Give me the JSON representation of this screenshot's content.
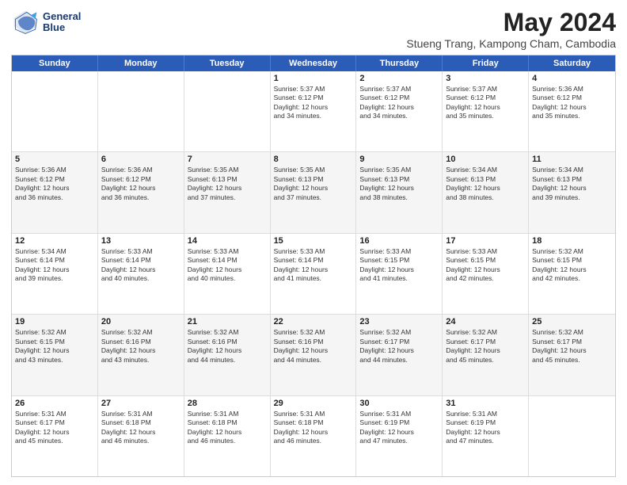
{
  "logo": {
    "line1": "General",
    "line2": "Blue"
  },
  "title": {
    "month_year": "May 2024",
    "location": "Stueng Trang, Kampong Cham, Cambodia"
  },
  "weekdays": [
    "Sunday",
    "Monday",
    "Tuesday",
    "Wednesday",
    "Thursday",
    "Friday",
    "Saturday"
  ],
  "rows": [
    {
      "alt": false,
      "cells": [
        {
          "day": "",
          "text": ""
        },
        {
          "day": "",
          "text": ""
        },
        {
          "day": "",
          "text": ""
        },
        {
          "day": "1",
          "text": "Sunrise: 5:37 AM\nSunset: 6:12 PM\nDaylight: 12 hours\nand 34 minutes."
        },
        {
          "day": "2",
          "text": "Sunrise: 5:37 AM\nSunset: 6:12 PM\nDaylight: 12 hours\nand 34 minutes."
        },
        {
          "day": "3",
          "text": "Sunrise: 5:37 AM\nSunset: 6:12 PM\nDaylight: 12 hours\nand 35 minutes."
        },
        {
          "day": "4",
          "text": "Sunrise: 5:36 AM\nSunset: 6:12 PM\nDaylight: 12 hours\nand 35 minutes."
        }
      ]
    },
    {
      "alt": true,
      "cells": [
        {
          "day": "5",
          "text": "Sunrise: 5:36 AM\nSunset: 6:12 PM\nDaylight: 12 hours\nand 36 minutes."
        },
        {
          "day": "6",
          "text": "Sunrise: 5:36 AM\nSunset: 6:12 PM\nDaylight: 12 hours\nand 36 minutes."
        },
        {
          "day": "7",
          "text": "Sunrise: 5:35 AM\nSunset: 6:13 PM\nDaylight: 12 hours\nand 37 minutes."
        },
        {
          "day": "8",
          "text": "Sunrise: 5:35 AM\nSunset: 6:13 PM\nDaylight: 12 hours\nand 37 minutes."
        },
        {
          "day": "9",
          "text": "Sunrise: 5:35 AM\nSunset: 6:13 PM\nDaylight: 12 hours\nand 38 minutes."
        },
        {
          "day": "10",
          "text": "Sunrise: 5:34 AM\nSunset: 6:13 PM\nDaylight: 12 hours\nand 38 minutes."
        },
        {
          "day": "11",
          "text": "Sunrise: 5:34 AM\nSunset: 6:13 PM\nDaylight: 12 hours\nand 39 minutes."
        }
      ]
    },
    {
      "alt": false,
      "cells": [
        {
          "day": "12",
          "text": "Sunrise: 5:34 AM\nSunset: 6:14 PM\nDaylight: 12 hours\nand 39 minutes."
        },
        {
          "day": "13",
          "text": "Sunrise: 5:33 AM\nSunset: 6:14 PM\nDaylight: 12 hours\nand 40 minutes."
        },
        {
          "day": "14",
          "text": "Sunrise: 5:33 AM\nSunset: 6:14 PM\nDaylight: 12 hours\nand 40 minutes."
        },
        {
          "day": "15",
          "text": "Sunrise: 5:33 AM\nSunset: 6:14 PM\nDaylight: 12 hours\nand 41 minutes."
        },
        {
          "day": "16",
          "text": "Sunrise: 5:33 AM\nSunset: 6:15 PM\nDaylight: 12 hours\nand 41 minutes."
        },
        {
          "day": "17",
          "text": "Sunrise: 5:33 AM\nSunset: 6:15 PM\nDaylight: 12 hours\nand 42 minutes."
        },
        {
          "day": "18",
          "text": "Sunrise: 5:32 AM\nSunset: 6:15 PM\nDaylight: 12 hours\nand 42 minutes."
        }
      ]
    },
    {
      "alt": true,
      "cells": [
        {
          "day": "19",
          "text": "Sunrise: 5:32 AM\nSunset: 6:15 PM\nDaylight: 12 hours\nand 43 minutes."
        },
        {
          "day": "20",
          "text": "Sunrise: 5:32 AM\nSunset: 6:16 PM\nDaylight: 12 hours\nand 43 minutes."
        },
        {
          "day": "21",
          "text": "Sunrise: 5:32 AM\nSunset: 6:16 PM\nDaylight: 12 hours\nand 44 minutes."
        },
        {
          "day": "22",
          "text": "Sunrise: 5:32 AM\nSunset: 6:16 PM\nDaylight: 12 hours\nand 44 minutes."
        },
        {
          "day": "23",
          "text": "Sunrise: 5:32 AM\nSunset: 6:17 PM\nDaylight: 12 hours\nand 44 minutes."
        },
        {
          "day": "24",
          "text": "Sunrise: 5:32 AM\nSunset: 6:17 PM\nDaylight: 12 hours\nand 45 minutes."
        },
        {
          "day": "25",
          "text": "Sunrise: 5:32 AM\nSunset: 6:17 PM\nDaylight: 12 hours\nand 45 minutes."
        }
      ]
    },
    {
      "alt": false,
      "cells": [
        {
          "day": "26",
          "text": "Sunrise: 5:31 AM\nSunset: 6:17 PM\nDaylight: 12 hours\nand 45 minutes."
        },
        {
          "day": "27",
          "text": "Sunrise: 5:31 AM\nSunset: 6:18 PM\nDaylight: 12 hours\nand 46 minutes."
        },
        {
          "day": "28",
          "text": "Sunrise: 5:31 AM\nSunset: 6:18 PM\nDaylight: 12 hours\nand 46 minutes."
        },
        {
          "day": "29",
          "text": "Sunrise: 5:31 AM\nSunset: 6:18 PM\nDaylight: 12 hours\nand 46 minutes."
        },
        {
          "day": "30",
          "text": "Sunrise: 5:31 AM\nSunset: 6:19 PM\nDaylight: 12 hours\nand 47 minutes."
        },
        {
          "day": "31",
          "text": "Sunrise: 5:31 AM\nSunset: 6:19 PM\nDaylight: 12 hours\nand 47 minutes."
        },
        {
          "day": "",
          "text": ""
        }
      ]
    }
  ]
}
